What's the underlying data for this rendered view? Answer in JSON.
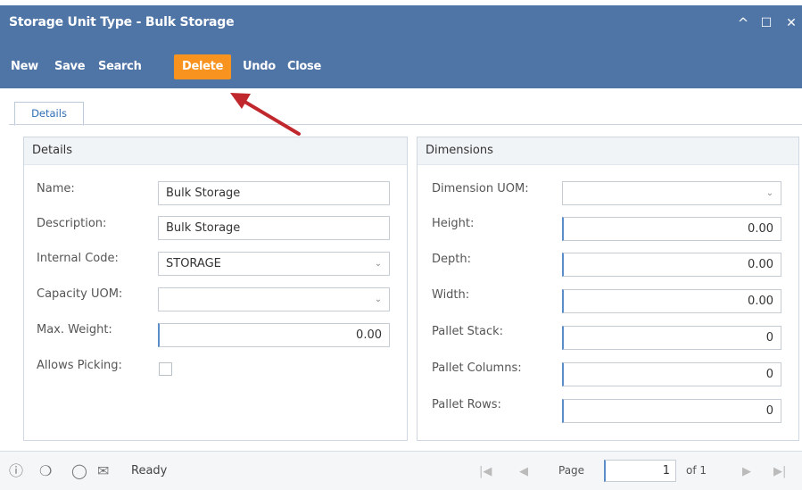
{
  "window": {
    "title": "Storage Unit Type - Bulk Storage",
    "controls": {
      "minimize": "^",
      "maximize": "☐",
      "close": "✕"
    }
  },
  "toolbar": {
    "new": "New",
    "save": "Save",
    "search": "Search",
    "delete": "Delete",
    "undo": "Undo",
    "close": "Close",
    "active_color": "#f7931e"
  },
  "tabs": {
    "details": "Details"
  },
  "details_panel": {
    "header": "Details",
    "name_label": "Name:",
    "name_value": "Bulk Storage",
    "description_label": "Description:",
    "description_value": "Bulk Storage",
    "internal_code_label": "Internal Code:",
    "internal_code_value": "STORAGE",
    "capacity_uom_label": "Capacity UOM:",
    "capacity_uom_value": "",
    "max_weight_label": "Max. Weight:",
    "max_weight_value": "0.00",
    "allows_picking_label": "Allows Picking:"
  },
  "dimensions_panel": {
    "header": "Dimensions",
    "dimension_uom_label": "Dimension UOM:",
    "dimension_uom_value": "",
    "height_label": "Height:",
    "height_value": "0.00",
    "depth_label": "Depth:",
    "depth_value": "0.00",
    "width_label": "Width:",
    "width_value": "0.00",
    "pallet_stack_label": "Pallet Stack:",
    "pallet_stack_value": "0",
    "pallet_columns_label": "Pallet Columns:",
    "pallet_columns_value": "0",
    "pallet_rows_label": "Pallet Rows:",
    "pallet_rows_value": "0"
  },
  "statusbar": {
    "status": "Ready",
    "page_label": "Page",
    "page_value": "1",
    "of_label": "of 1"
  },
  "colors": {
    "titlebar": "#4f74a6",
    "annotation_arrow": "#c0282d"
  }
}
